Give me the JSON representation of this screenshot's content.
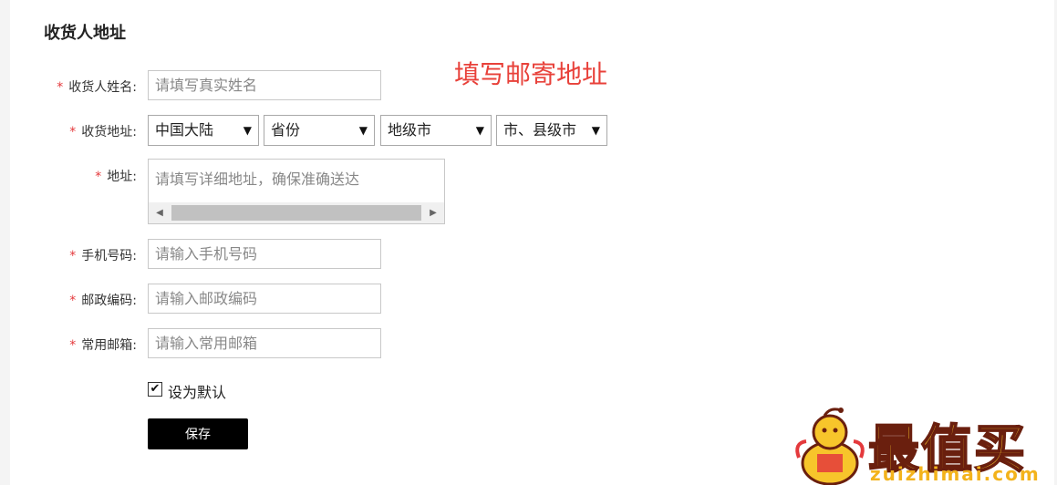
{
  "section_title": "收货人地址",
  "annotation": "填写邮寄地址",
  "required_mark": "*",
  "fields": {
    "name": {
      "label": "收货人姓名:",
      "placeholder": "请填写真实姓名"
    },
    "region": {
      "label": "收货地址:",
      "country": "中国大陆",
      "province": "省份",
      "city": "地级市",
      "county": "市、县级市"
    },
    "address": {
      "label": "地址:",
      "placeholder": "请填写详细地址，确保准确送达"
    },
    "phone": {
      "label": "手机号码:",
      "placeholder": "请输入手机号码"
    },
    "postcode": {
      "label": "邮政编码:",
      "placeholder": "请输入邮政编码"
    },
    "email": {
      "label": "常用邮箱:",
      "placeholder": "请输入常用邮箱"
    }
  },
  "default_checkbox": {
    "label": "设为默认",
    "checked": true
  },
  "save_button": "保存",
  "icons": {
    "select_arrow": "▼",
    "scroll_left": "◀",
    "scroll_right": "▶",
    "check": "✔"
  },
  "logo": {
    "text": "最值买",
    "site": "zuizhimai.com"
  },
  "colors": {
    "required": "#e4393c",
    "annotation": "#e8413a",
    "button_bg": "#000000",
    "logo_yellow": "#f7c52b"
  }
}
